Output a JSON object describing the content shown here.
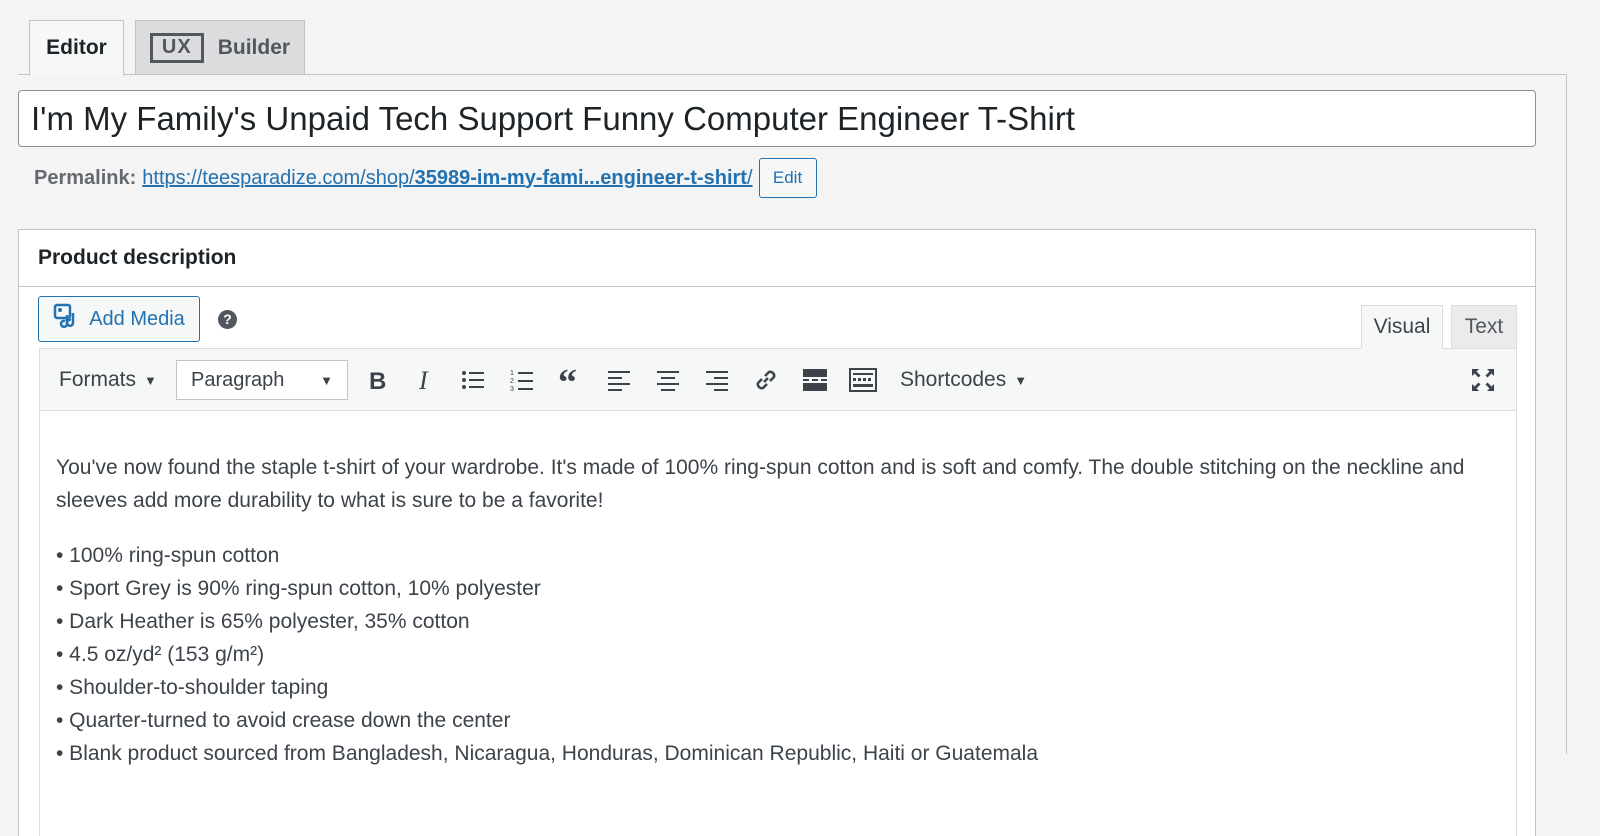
{
  "tabs": {
    "editor_label": "Editor",
    "builder_ux": "UX",
    "builder_label": "Builder"
  },
  "post": {
    "title": "I'm My Family's Unpaid Tech Support Funny Computer Engineer T-Shirt"
  },
  "permalink": {
    "label": "Permalink:",
    "url_prefix": "https://teesparadize.com/shop/",
    "url_slug": "35989-im-my-fami...engineer-t-shirt",
    "url_suffix": "/",
    "edit_label": "Edit"
  },
  "panel": {
    "title": "Product description",
    "add_media_label": "Add Media",
    "help_glyph": "?",
    "mode_visual": "Visual",
    "mode_text": "Text"
  },
  "toolbar": {
    "formats_label": "Formats",
    "paragraph_select": "Paragraph",
    "shortcodes_label": "Shortcodes",
    "icons": [
      "bold-icon",
      "italic-icon",
      "bulleted-list-icon",
      "numbered-list-icon",
      "blockquote-icon",
      "align-left-icon",
      "align-center-icon",
      "align-right-icon",
      "link-icon",
      "read-more-icon",
      "toolbar-toggle-icon",
      "fullscreen-icon"
    ]
  },
  "content": {
    "paragraph": "You've now found the staple t-shirt of your wardrobe. It's made of 100% ring-spun cotton and is soft and comfy. The double stitching on the neckline and sleeves add more durability to what is sure to be a favorite!",
    "bullets": [
      "• 100% ring-spun cotton",
      "• Sport Grey is 90% ring-spun cotton, 10% polyester",
      "• Dark Heather is 65% polyester, 35% cotton",
      "• 4.5 oz/yd² (153 g/m²)",
      "• Shoulder-to-shoulder taping",
      "• Quarter-turned to avoid crease down the center",
      "• Blank product sourced from Bangladesh, Nicaragua, Honduras, Dominican Republic, Haiti or Guatemala"
    ]
  },
  "colors": {
    "link": "#2271b1",
    "text": "#1d2327",
    "background": "#f4f4f4"
  }
}
